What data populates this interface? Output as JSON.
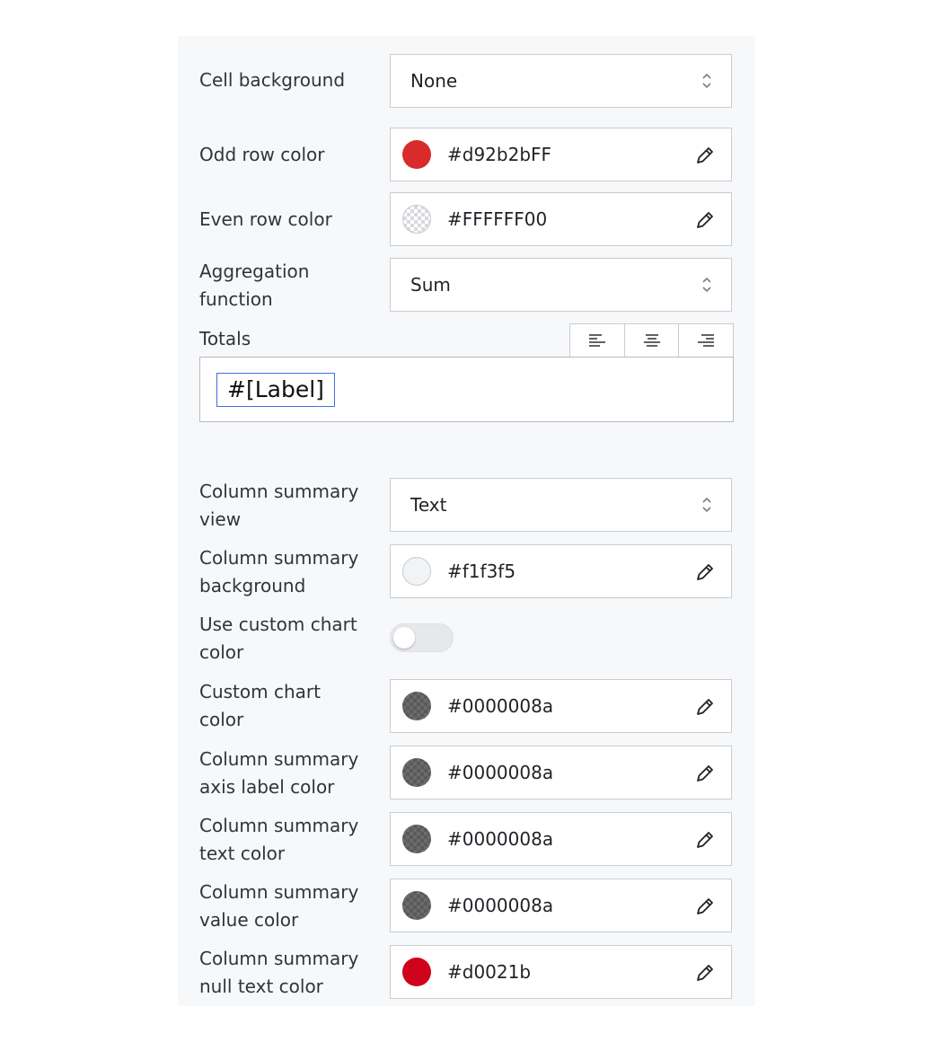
{
  "fields": {
    "cell_background": {
      "label": "Cell background",
      "value": "None"
    },
    "odd_row_color": {
      "label": "Odd row color",
      "value": "#d92b2bFF",
      "swatch": "#d92b2b"
    },
    "even_row_color": {
      "label": "Even row color",
      "value": "#FFFFFF00",
      "swatch": "transparent"
    },
    "aggregation_function": {
      "label": "Aggregation function",
      "value": "Sum"
    },
    "totals": {
      "label": "Totals",
      "value": "#[Label]"
    },
    "column_summary_view": {
      "label": "Column summary view",
      "value": "Text"
    },
    "column_summary_background": {
      "label": "Column summary background",
      "value": "#f1f3f5",
      "swatch": "#f1f3f5"
    },
    "use_custom_chart_color": {
      "label": "Use custom chart color",
      "enabled": false
    },
    "custom_chart_color": {
      "label": "Custom chart color",
      "value": "#0000008a",
      "swatch": "#0000008a"
    },
    "column_summary_axis_label_color": {
      "label": "Column summary axis label color",
      "value": "#0000008a",
      "swatch": "#0000008a"
    },
    "column_summary_text_color": {
      "label": "Column summary text color",
      "value": "#0000008a",
      "swatch": "#0000008a"
    },
    "column_summary_value_color": {
      "label": "Column summary value color",
      "value": "#0000008a",
      "swatch": "#0000008a"
    },
    "column_summary_null_text_color": {
      "label": "Column summary null text color",
      "value": "#d0021b",
      "swatch": "#d0021b"
    }
  },
  "icons": {
    "select": "chevron-up-down-icon",
    "color_picker": "pencil-icon",
    "align": [
      "align-left-icon",
      "align-center-icon",
      "align-right-icon"
    ]
  },
  "colors": {
    "panel_background": "#f7f8f9",
    "border": "#c9ccd1",
    "chip_border": "#3f6fe0"
  }
}
